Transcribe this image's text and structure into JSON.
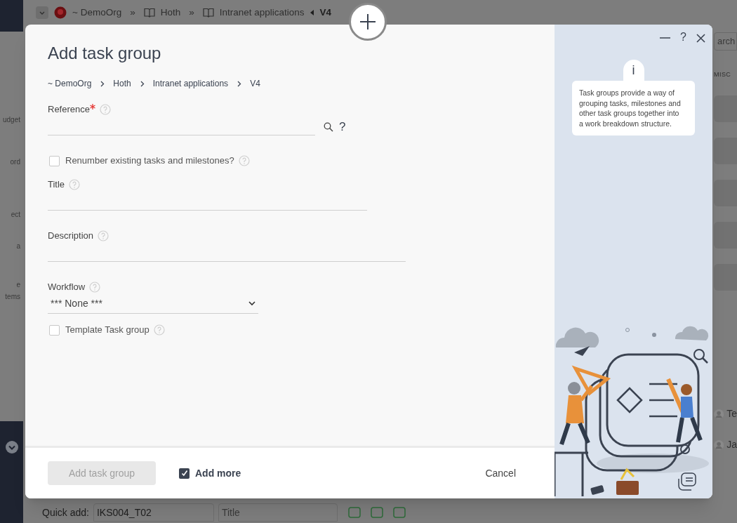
{
  "background": {
    "breadcrumb": [
      {
        "label": "~ DemoOrg",
        "kind": "org"
      },
      {
        "label": "Hoth",
        "kind": "book"
      },
      {
        "label": "Intranet applications",
        "kind": "book"
      },
      {
        "label": "V4",
        "kind": "current"
      }
    ],
    "separator": "»",
    "side_labels": [
      "udget",
      "ord",
      "ect",
      "a",
      "e",
      "tems"
    ],
    "search": {
      "placeholder": "arch"
    },
    "misc_heading": "MISC",
    "users": [
      "Te",
      "Ja"
    ],
    "quick_add": {
      "label": "Quick add:",
      "value": "IKS004_T02",
      "title_placeholder": "Title"
    }
  },
  "dialog": {
    "title": "Add task group",
    "breadcrumb": [
      "~ DemoOrg",
      "Hoth",
      "Intranet applications",
      "V4"
    ],
    "fields": [
      {
        "kind": "text",
        "label": "Reference",
        "required": true,
        "lookup": true,
        "lookup_help": "?"
      },
      {
        "kind": "checkbox",
        "label": "Renumber existing tasks and milestones?",
        "checked": false
      },
      {
        "kind": "text",
        "label": "Title",
        "required": false,
        "lookup": false
      },
      {
        "kind": "text",
        "label": "Description",
        "required": false,
        "lookup": false
      },
      {
        "kind": "select",
        "label": "Workflow",
        "value": "*** None ***"
      },
      {
        "kind": "checkbox",
        "label": "Template Task group",
        "checked": false
      }
    ],
    "help_char": "?",
    "info_badge": "i",
    "info": "Task groups provide a way of grouping tasks, milestones and other task groups together into a work breakdown structure.",
    "submit": {
      "label": "Add task group",
      "disabled": true
    },
    "add_more": {
      "label": "Add more",
      "checked": true
    },
    "cancel": "Cancel"
  }
}
